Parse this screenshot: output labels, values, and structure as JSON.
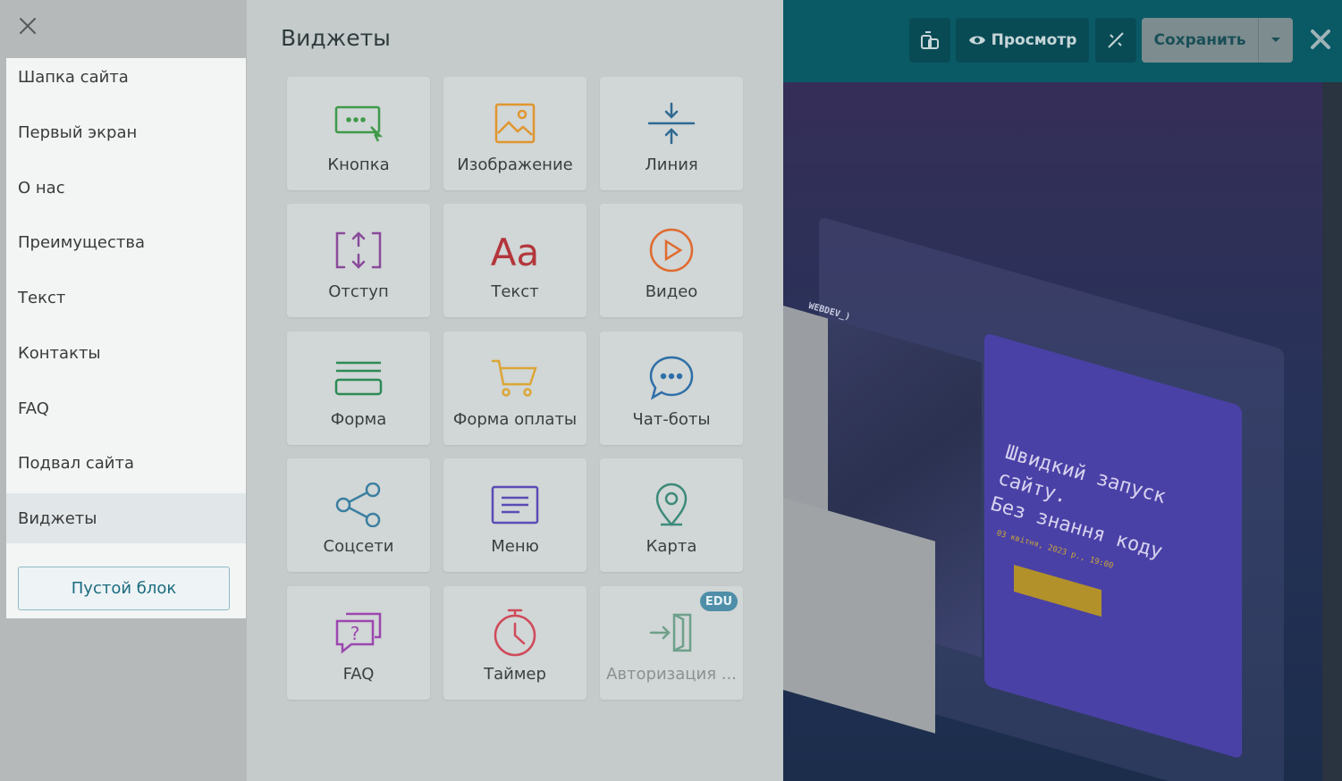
{
  "sidebar": {
    "sections": [
      {
        "label": "Шапка сайта"
      },
      {
        "label": "Первый экран"
      },
      {
        "label": "О нас"
      },
      {
        "label": "Преимущества"
      },
      {
        "label": "Текст"
      },
      {
        "label": "Контакты"
      },
      {
        "label": "FAQ"
      },
      {
        "label": "Подвал сайта"
      },
      {
        "label": "Виджеты",
        "active": true
      }
    ],
    "empty_block_label": "Пустой блок"
  },
  "widgets": {
    "title": "Виджеты",
    "items": [
      {
        "label": "Кнопка",
        "icon": "button-cursor-icon",
        "color": "#3f9a4a"
      },
      {
        "label": "Изображение",
        "icon": "image-icon",
        "color": "#e0962f"
      },
      {
        "label": "Линия",
        "icon": "line-icon",
        "color": "#2f6a93"
      },
      {
        "label": "Отступ",
        "icon": "spacing-icon",
        "color": "#8a4a9b"
      },
      {
        "label": "Текст",
        "icon": "text-aa-icon",
        "color": "#b3363b"
      },
      {
        "label": "Видео",
        "icon": "video-play-icon",
        "color": "#e06a2f"
      },
      {
        "label": "Форма",
        "icon": "form-icon",
        "color": "#2d8a55"
      },
      {
        "label": "Форма оплаты",
        "icon": "cart-icon",
        "color": "#dba636"
      },
      {
        "label": "Чат-боты",
        "icon": "chat-icon",
        "color": "#2f6fa8"
      },
      {
        "label": "Соцсети",
        "icon": "share-icon",
        "color": "#3a7fa0"
      },
      {
        "label": "Меню",
        "icon": "menu-icon",
        "color": "#5b4bb5"
      },
      {
        "label": "Карта",
        "icon": "map-pin-icon",
        "color": "#3d8a7a"
      },
      {
        "label": "FAQ",
        "icon": "faq-icon",
        "color": "#9b47b0"
      },
      {
        "label": "Таймер",
        "icon": "timer-icon",
        "color": "#cf4a5a"
      },
      {
        "label": "Авторизация ...",
        "icon": "login-icon",
        "color": "#6ea08a",
        "badge": "EDU",
        "disabled": true
      }
    ]
  },
  "topbar": {
    "preview_label": "Просмотр",
    "save_label": "Сохранить"
  },
  "preview": {
    "brand": "WEBDEV_)",
    "headline": "Швидкий запуск\nсайту.\nБез знання коду",
    "date": "03 квітня, 2023 р., 19:00"
  },
  "colors": {
    "topbar": "#0a5a66",
    "accent": "#1a6c80",
    "overlay": "#c5cbcb"
  }
}
